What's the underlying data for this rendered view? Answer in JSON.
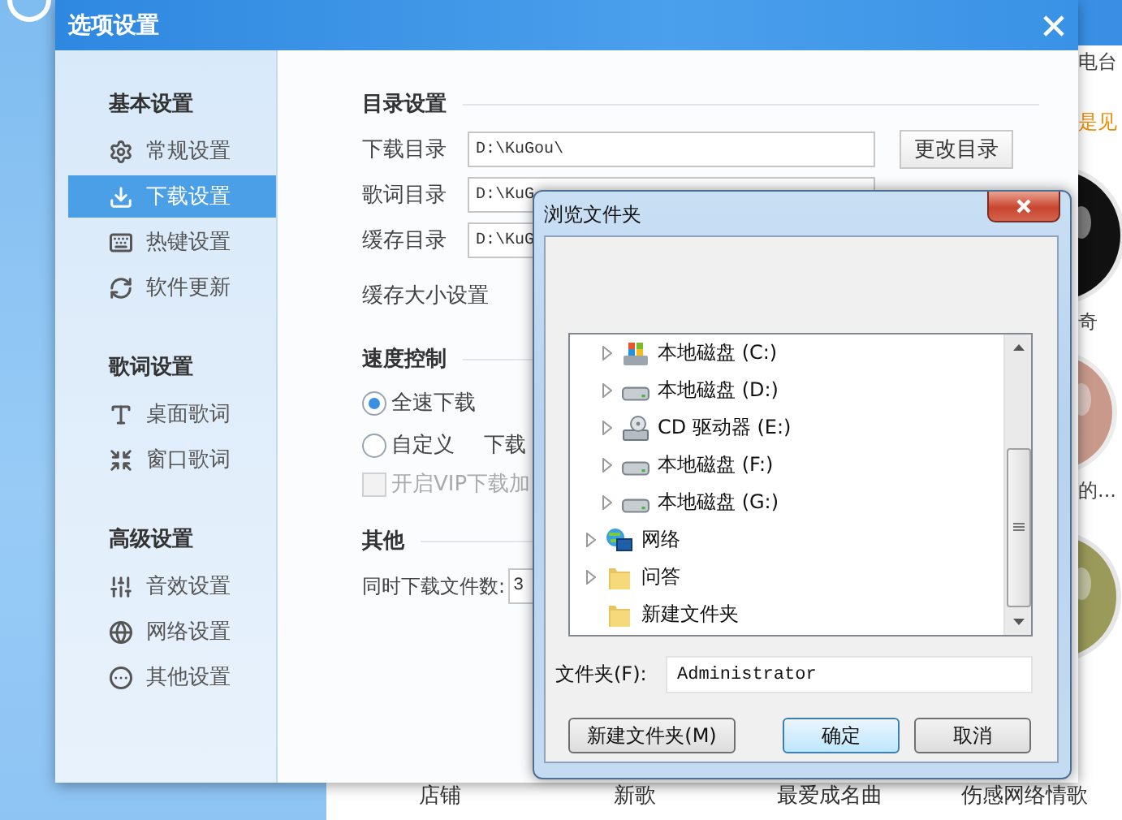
{
  "background": {
    "side_texts": [
      {
        "text": "电台",
        "kind": "plain"
      },
      {
        "text": "是见",
        "kind": "highlight"
      },
      {
        "text": "奇",
        "kind": "plain"
      },
      {
        "text": "的...",
        "kind": "plain"
      }
    ],
    "bottom_labels": [
      "店铺",
      "新歌",
      "最爱成名曲",
      "伤感网络情歌"
    ]
  },
  "settings": {
    "title": "选项设置",
    "sidebar": [
      {
        "heading": "基本设置",
        "items": [
          {
            "label": "常规设置",
            "selected": false
          },
          {
            "label": "下载设置",
            "selected": true
          },
          {
            "label": "热键设置",
            "selected": false
          },
          {
            "label": "软件更新",
            "selected": false
          }
        ]
      },
      {
        "heading": "歌词设置",
        "items": [
          {
            "label": "桌面歌词",
            "selected": false
          },
          {
            "label": "窗口歌词",
            "selected": false
          }
        ]
      },
      {
        "heading": "高级设置",
        "items": [
          {
            "label": "音效设置",
            "selected": false
          },
          {
            "label": "网络设置",
            "selected": false
          },
          {
            "label": "其他设置",
            "selected": false
          }
        ]
      }
    ],
    "directory": {
      "heading": "目录设置",
      "rows": [
        {
          "label": "下载目录",
          "value": "D:\\KuGou\\",
          "button": "更改目录"
        },
        {
          "label": "歌词目录",
          "value": "D:\\KuG"
        },
        {
          "label": "缓存目录",
          "value": "D:\\KuG"
        }
      ],
      "cache_label": "缓存大小设置"
    },
    "speed": {
      "heading": "速度控制",
      "options": [
        {
          "label": "全速下载",
          "selected": true
        },
        {
          "label": "自定义",
          "selected": false,
          "extra": "下载"
        }
      ],
      "vip": {
        "label": "开启VIP下载加",
        "checked": false,
        "disabled": true
      }
    },
    "other": {
      "heading": "其他",
      "label": "同时下载文件数:",
      "value": "3"
    }
  },
  "browse": {
    "title": "浏览文件夹",
    "tree": [
      {
        "label": "本地磁盘 (C:)",
        "kind": "system_drive",
        "expandable": true
      },
      {
        "label": "本地磁盘 (D:)",
        "kind": "drive",
        "expandable": true
      },
      {
        "label": "CD 驱动器 (E:)",
        "kind": "cd_drive",
        "expandable": true
      },
      {
        "label": "本地磁盘 (F:)",
        "kind": "drive",
        "expandable": true
      },
      {
        "label": "本地磁盘 (G:)",
        "kind": "drive",
        "expandable": true
      },
      {
        "label": "网络",
        "kind": "network",
        "expandable": true
      },
      {
        "label": "问答",
        "kind": "folder",
        "expandable": true
      },
      {
        "label": "新建文件夹",
        "kind": "folder",
        "expandable": false
      }
    ],
    "folder_label": "文件夹(F):",
    "folder_value": "Administrator",
    "buttons": [
      {
        "label": "新建文件夹(M)",
        "default": false
      },
      {
        "label": "确定",
        "default": true
      },
      {
        "label": "取消",
        "default": false
      }
    ]
  }
}
